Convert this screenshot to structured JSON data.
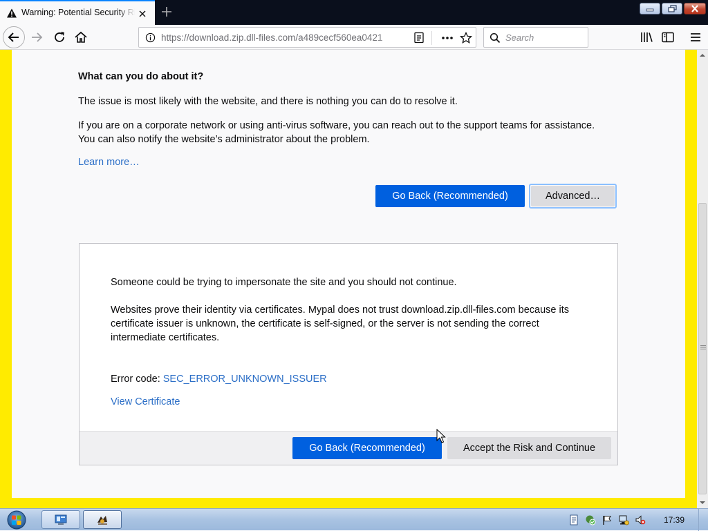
{
  "browser": {
    "tab_title": "Warning: Potential Security Risk",
    "url": "https://download.zip.dll-files.com/a489cecf560ea0421",
    "search_placeholder": "Search"
  },
  "error_page": {
    "heading": "What can you do about it?",
    "para1": "The issue is most likely with the website, and there is nothing you can do to resolve it.",
    "para2_line1": "If you are on a corporate network or using anti-virus software, you can reach out to the support teams for assistance.",
    "para2_line2": "You can also notify the website’s administrator about the problem.",
    "learn_more": "Learn more…",
    "go_back_label": "Go Back (Recommended)",
    "advanced_label": "Advanced…"
  },
  "advanced_panel": {
    "warning": "Someone could be trying to impersonate the site and you should not continue.",
    "desc_line1": "Websites prove their identity via certificates. Mypal does not trust download.zip.dll-files.com because its",
    "desc_line2": "certificate issuer is unknown, the certificate is self-signed, or the server is not sending the correct",
    "desc_line3": "intermediate certificates.",
    "error_code_label": "Error code:",
    "error_code": "SEC_ERROR_UNKNOWN_ISSUER",
    "view_certificate": "View Certificate",
    "go_back_label": "Go Back (Recommended)",
    "accept_label": "Accept the Risk and Continue"
  },
  "taskbar": {
    "clock": "17:39"
  },
  "colors": {
    "page_frame": "#ffeb00",
    "primary_button": "#0060df",
    "link": "#2c6fc7"
  }
}
